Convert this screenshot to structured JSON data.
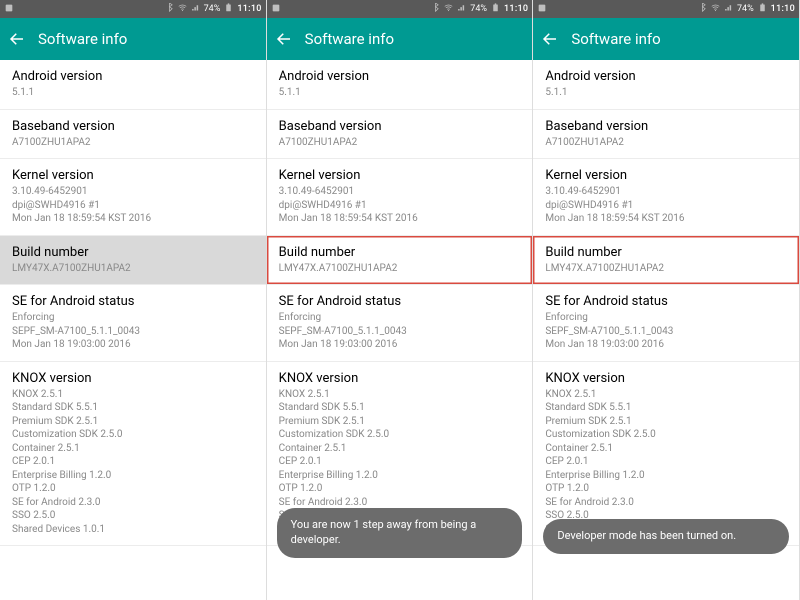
{
  "status": {
    "battery": "74%",
    "time": "11:10"
  },
  "appbar": {
    "title": "Software info"
  },
  "rows": {
    "android": {
      "title": "Android version",
      "sub": "5.1.1"
    },
    "baseband": {
      "title": "Baseband version",
      "sub": "A7100ZHU1APA2"
    },
    "kernel": {
      "title": "Kernel version",
      "sub": "3.10.49-6452901\ndpi@SWHD4916 #1\nMon Jan 18 18:59:54 KST 2016"
    },
    "build": {
      "title": "Build number",
      "sub": "LMY47X.A7100ZHU1APA2"
    },
    "se": {
      "title": "SE for Android status",
      "sub": "Enforcing\nSEPF_SM-A7100_5.1.1_0043\nMon Jan 18 19:03:00 2016"
    },
    "knox": {
      "title": "KNOX version",
      "sub": "KNOX 2.5.1\nStandard SDK 5.5.1\nPremium SDK 2.5.1\nCustomization SDK 2.5.0\nContainer 2.5.1\nCEP 2.0.1\nEnterprise Billing 1.2.0\nOTP 1.2.0\nSE for Android 2.3.0\nSSO 2.5.0\nShared Devices 1.0.1"
    }
  },
  "toast1": "You are now 1 step away from being a developer.",
  "toast2": "Developer mode has been turned on."
}
